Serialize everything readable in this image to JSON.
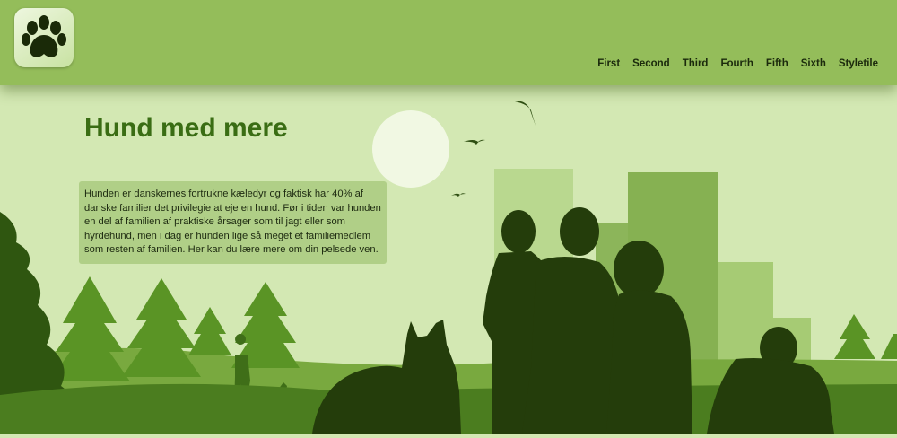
{
  "header": {
    "logo_icon": "paw-icon",
    "nav": [
      {
        "label": "First"
      },
      {
        "label": "Second"
      },
      {
        "label": "Third"
      },
      {
        "label": "Fourth"
      },
      {
        "label": "Fifth"
      },
      {
        "label": "Sixth"
      },
      {
        "label": "Styletile"
      }
    ]
  },
  "hero": {
    "title": "Hund med mere",
    "intro": "Hunden er danskernes fortrukne kæledyr og faktisk har 40% af danske familier det privilegie at eje en hund. Før i tiden var hunden en del af familien af praktiske årsager som til jagt eller som hyrdehund, men i dag er hunden lige så meget et familiemedlem som resten af familien. Her kan du lære mere om din pelsede ven."
  },
  "colors": {
    "header": "#94bd5a",
    "background": "#d3e8b3",
    "title": "#3a6d14",
    "silhouette": "#243d0b",
    "trees": "#4f8a1c"
  }
}
